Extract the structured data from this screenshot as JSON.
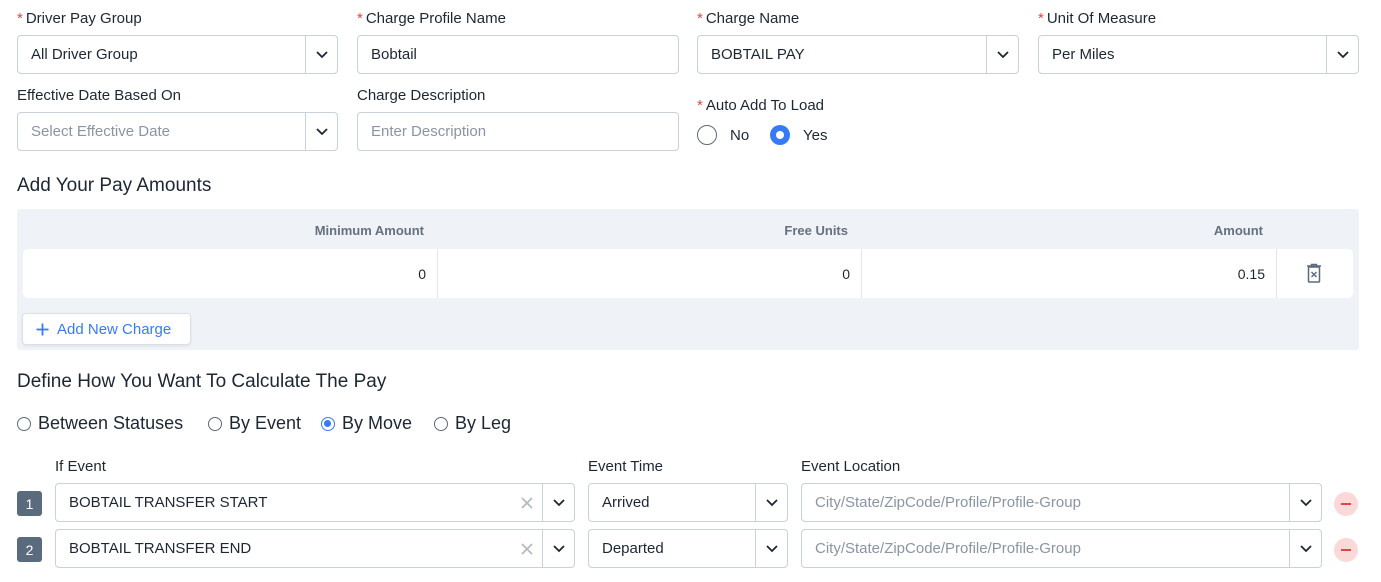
{
  "form": {
    "driver_pay_group": {
      "label": "Driver Pay Group",
      "value": "All Driver Group"
    },
    "charge_profile_name": {
      "label": "Charge Profile Name",
      "value": "Bobtail"
    },
    "charge_name": {
      "label": "Charge Name",
      "value": "BOBTAIL PAY"
    },
    "unit_of_measure": {
      "label": "Unit Of Measure",
      "value": "Per Miles"
    },
    "effective_date": {
      "label": "Effective Date Based On",
      "placeholder": "Select Effective Date"
    },
    "charge_description": {
      "label": "Charge Description",
      "placeholder": "Enter Description"
    },
    "auto_add": {
      "label": "Auto Add To Load",
      "options": [
        "No",
        "Yes"
      ],
      "selected": "Yes"
    },
    "required_mark": "*"
  },
  "pay_amounts": {
    "title": "Add Your Pay Amounts",
    "columns": [
      "Minimum Amount",
      "Free Units",
      "Amount"
    ],
    "rows": [
      {
        "minimum_amount": "0",
        "free_units": "0",
        "amount": "0.15"
      }
    ],
    "add_label": "Add New Charge"
  },
  "calculation": {
    "title": "Define How You Want To Calculate The Pay",
    "methods": [
      "Between Statuses",
      "By Event",
      "By Move",
      "By Leg"
    ],
    "selected": "By Move",
    "headers": {
      "event": "If Event",
      "time": "Event Time",
      "location": "Event Location"
    },
    "rows": [
      {
        "num": "1",
        "event": "BOBTAIL TRANSFER START",
        "time": "Arrived",
        "location_placeholder": "City/State/ZipCode/Profile/Profile-Group"
      },
      {
        "num": "2",
        "event": "BOBTAIL TRANSFER END",
        "time": "Departed",
        "location_placeholder": "City/State/ZipCode/Profile/Profile-Group"
      }
    ]
  },
  "colors": {
    "accent": "#367bf5",
    "required": "#e04646",
    "badge": "#5b6b7e",
    "panel": "#eff2f6"
  }
}
